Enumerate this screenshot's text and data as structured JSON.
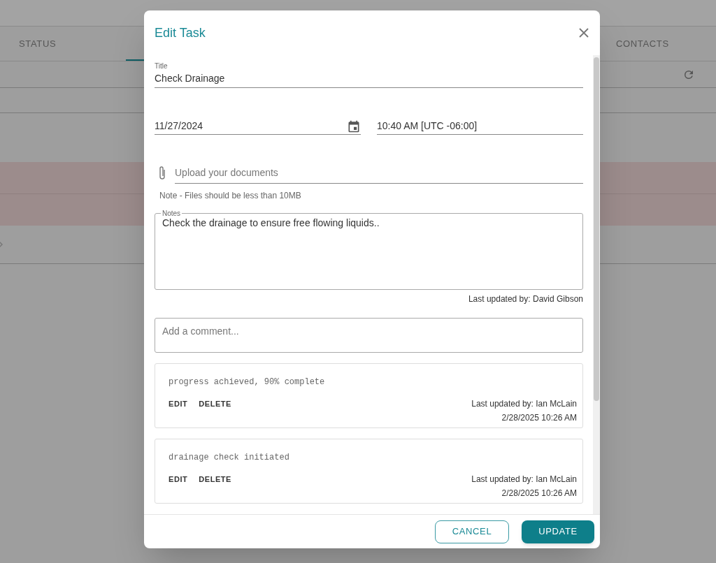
{
  "background": {
    "tabs": [
      {
        "label": "STATUS",
        "selected": false
      },
      {
        "label": "CONTACTS",
        "selected": false
      }
    ]
  },
  "dialog": {
    "title": "Edit Task",
    "title_field": {
      "label": "Title",
      "value": "Check Drainage"
    },
    "date_field": {
      "value": "11/27/2024"
    },
    "time_field": {
      "value": "10:40 AM [UTC -06:00]"
    },
    "upload_field": {
      "placeholder": "Upload your documents"
    },
    "upload_note": "Note - Files should be less than 10MB",
    "notes": {
      "label": "Notes",
      "value": "Check the drainage to ensure free flowing liquids.."
    },
    "notes_updated": "Last updated by: David Gibson",
    "comment_field": {
      "placeholder": "Add a comment..."
    },
    "comments": [
      {
        "text": "progress achieved, 90% complete",
        "actions": [
          "EDIT",
          "DELETE"
        ],
        "updated_by": "Last updated by: Ian McLain",
        "timestamp": "2/28/2025 10:26 AM"
      },
      {
        "text": "drainage check initiated",
        "actions": [
          "EDIT",
          "DELETE"
        ],
        "updated_by": "Last updated by: Ian McLain",
        "timestamp": "2/28/2025 10:26 AM"
      }
    ],
    "buttons": [
      {
        "label": "CANCEL",
        "kind": "outlined"
      },
      {
        "label": "UPDATE",
        "kind": "filled"
      }
    ]
  }
}
